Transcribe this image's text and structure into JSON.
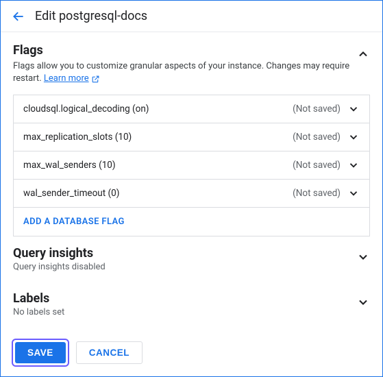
{
  "header": {
    "title": "Edit postgresql-docs"
  },
  "flags": {
    "title": "Flags",
    "description": "Flags allow you to customize granular aspects of your instance. Changes may require restart.",
    "learn_more": "Learn more",
    "items": [
      {
        "label": "cloudsql.logical_decoding (on)",
        "status": "(Not saved)"
      },
      {
        "label": "max_replication_slots (10)",
        "status": "(Not saved)"
      },
      {
        "label": "max_wal_senders (10)",
        "status": "(Not saved)"
      },
      {
        "label": "wal_sender_timeout (0)",
        "status": "(Not saved)"
      }
    ],
    "add_label": "ADD A DATABASE FLAG"
  },
  "query_insights": {
    "title": "Query insights",
    "sub": "Query insights disabled"
  },
  "labels": {
    "title": "Labels",
    "sub": "No labels set"
  },
  "footer": {
    "save": "SAVE",
    "cancel": "CANCEL"
  }
}
